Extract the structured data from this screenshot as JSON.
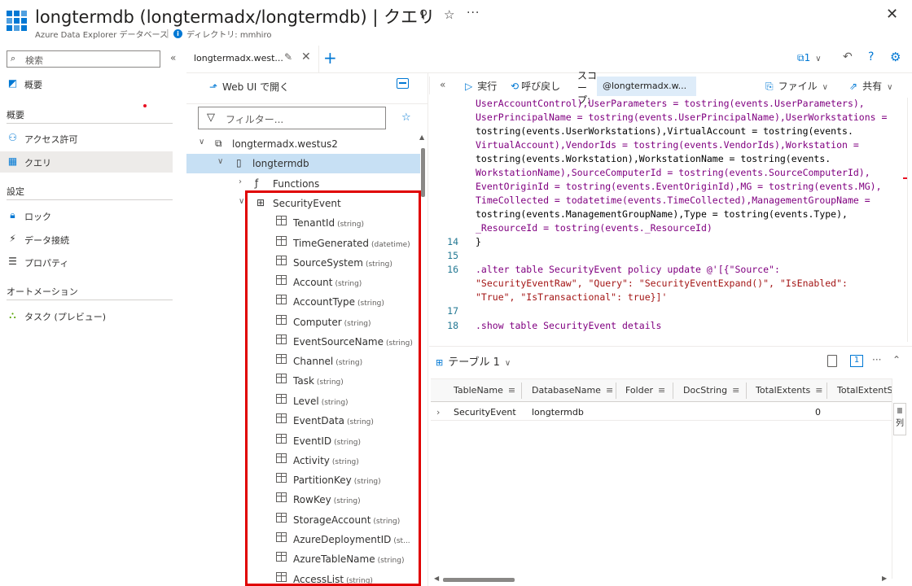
{
  "header": {
    "title": "longtermdb (longtermadx/longtermdb) | クエリ",
    "subtitle": "Azure Data Explorer データベース",
    "directory": "ディレクトリ: mmhiro",
    "pin_icon": "pin-icon",
    "star_icon": "star-icon",
    "more_icon": "more-icon",
    "close_icon": "close-icon"
  },
  "nav": {
    "search_placeholder": "検索",
    "collapse_label": "«",
    "overview": "概要",
    "sections": {
      "overview_section": "概要",
      "settings": "設定",
      "automation": "オートメーション"
    },
    "items": [
      {
        "label": "アクセス許可",
        "icon": "people-icon"
      },
      {
        "label": "クエリ",
        "icon": "query-icon"
      },
      {
        "label": "ロック",
        "icon": "lock-icon"
      },
      {
        "label": "データ接続",
        "icon": "plug-icon"
      },
      {
        "label": "プロパティ",
        "icon": "properties-icon"
      },
      {
        "label": "タスク (プレビュー)",
        "icon": "tasks-icon"
      }
    ]
  },
  "tabs": {
    "active_tab": "longtermadx.west...",
    "add_label": "+",
    "copies": "1"
  },
  "explorer": {
    "open_web_ui": "Web UI で開く",
    "filter_placeholder": "フィルター...",
    "cluster": "longtermadx.westus2",
    "database": "longtermdb",
    "functions": "Functions",
    "table": "SecurityEvent",
    "columns": [
      {
        "name": "TenantId",
        "type": "(string)"
      },
      {
        "name": "TimeGenerated",
        "type": "(datetime)"
      },
      {
        "name": "SourceSystem",
        "type": "(string)"
      },
      {
        "name": "Account",
        "type": "(string)"
      },
      {
        "name": "AccountType",
        "type": "(string)"
      },
      {
        "name": "Computer",
        "type": "(string)"
      },
      {
        "name": "EventSourceName",
        "type": "(string)"
      },
      {
        "name": "Channel",
        "type": "(string)"
      },
      {
        "name": "Task",
        "type": "(string)"
      },
      {
        "name": "Level",
        "type": "(string)"
      },
      {
        "name": "EventData",
        "type": "(string)"
      },
      {
        "name": "EventID",
        "type": "(string)"
      },
      {
        "name": "Activity",
        "type": "(string)"
      },
      {
        "name": "PartitionKey",
        "type": "(string)"
      },
      {
        "name": "RowKey",
        "type": "(string)"
      },
      {
        "name": "StorageAccount",
        "type": "(string)"
      },
      {
        "name": "AzureDeploymentID",
        "type": "(st..."
      },
      {
        "name": "AzureTableName",
        "type": "(string)"
      },
      {
        "name": "AccessList",
        "type": "(string)"
      }
    ]
  },
  "query_toolbar": {
    "run": "実行",
    "recall": "呼び戻し",
    "scope_label": "スコープ:",
    "scope_value": "@longtermadx.w...",
    "file": "ファイル",
    "share": "共有"
  },
  "editor": {
    "line_numbers": [
      "14",
      "15",
      "16",
      "17",
      "18"
    ],
    "lines": [
      "UserAccountControl),UserParameters = tostring(events.UserParameters),",
      "UserPrincipalName = tostring(events.UserPrincipalName),UserWorkstations =",
      "tostring(events.UserWorkstations),VirtualAccount = tostring(events.",
      "VirtualAccount),VendorIds = tostring(events.VendorIds),Workstation =",
      "tostring(events.Workstation),WorkstationName = tostring(events.",
      "WorkstationName),SourceComputerId = tostring(events.SourceComputerId),",
      "EventOriginId = tostring(events.EventOriginId),MG = tostring(events.MG),",
      "TimeCollected = todatetime(events.TimeCollected),ManagementGroupName =",
      "tostring(events.ManagementGroupName),Type = tostring(events.Type),",
      "_ResourceId = tostring(events._ResourceId)",
      "}",
      "",
      ".alter table SecurityEvent policy update @'[{\"Source\":",
      "\"SecurityEventRaw\", \"Query\": \"SecurityEventExpand()\", \"IsEnabled\":",
      "\"True\", \"IsTransactional\": true}]'",
      "",
      ".show table SecurityEvent details"
    ]
  },
  "results": {
    "tab_label": "テーブル 1",
    "columns": [
      "TableName",
      "DatabaseName",
      "Folder",
      "DocString",
      "TotalExtents",
      "TotalExtentSiz"
    ],
    "rows": [
      {
        "TableName": "SecurityEvent",
        "DatabaseName": "longtermdb",
        "Folder": "",
        "DocString": "",
        "TotalExtents": "0"
      }
    ],
    "side_label": "列"
  },
  "colors": {
    "accent": "#0078d4",
    "selected_row": "#c7e0f4",
    "highlight": "#e00000"
  }
}
